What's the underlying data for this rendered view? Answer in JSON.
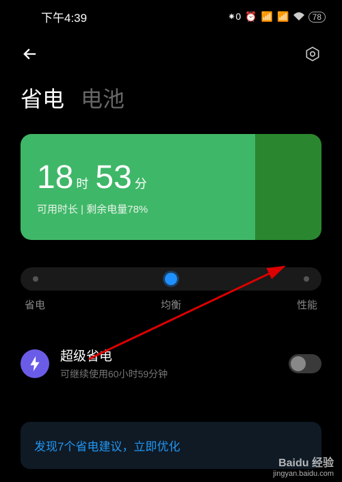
{
  "status": {
    "time": "下午4:39",
    "battery": "78"
  },
  "tabs": {
    "active": "省电",
    "inactive": "电池"
  },
  "battery_card": {
    "hours": "18",
    "hours_unit": "时",
    "minutes": "53",
    "minutes_unit": "分",
    "subtitle": "可用时长 | 剩余电量78%"
  },
  "slider": {
    "left": "省电",
    "mid": "均衡",
    "right": "性能"
  },
  "super_save": {
    "title": "超级省电",
    "subtitle": "可继续使用60小时59分钟"
  },
  "suggestion": "发现7个省电建议，立即优化",
  "watermark": {
    "brand": "Baidu 经验",
    "url": "jingyan.baidu.com"
  }
}
